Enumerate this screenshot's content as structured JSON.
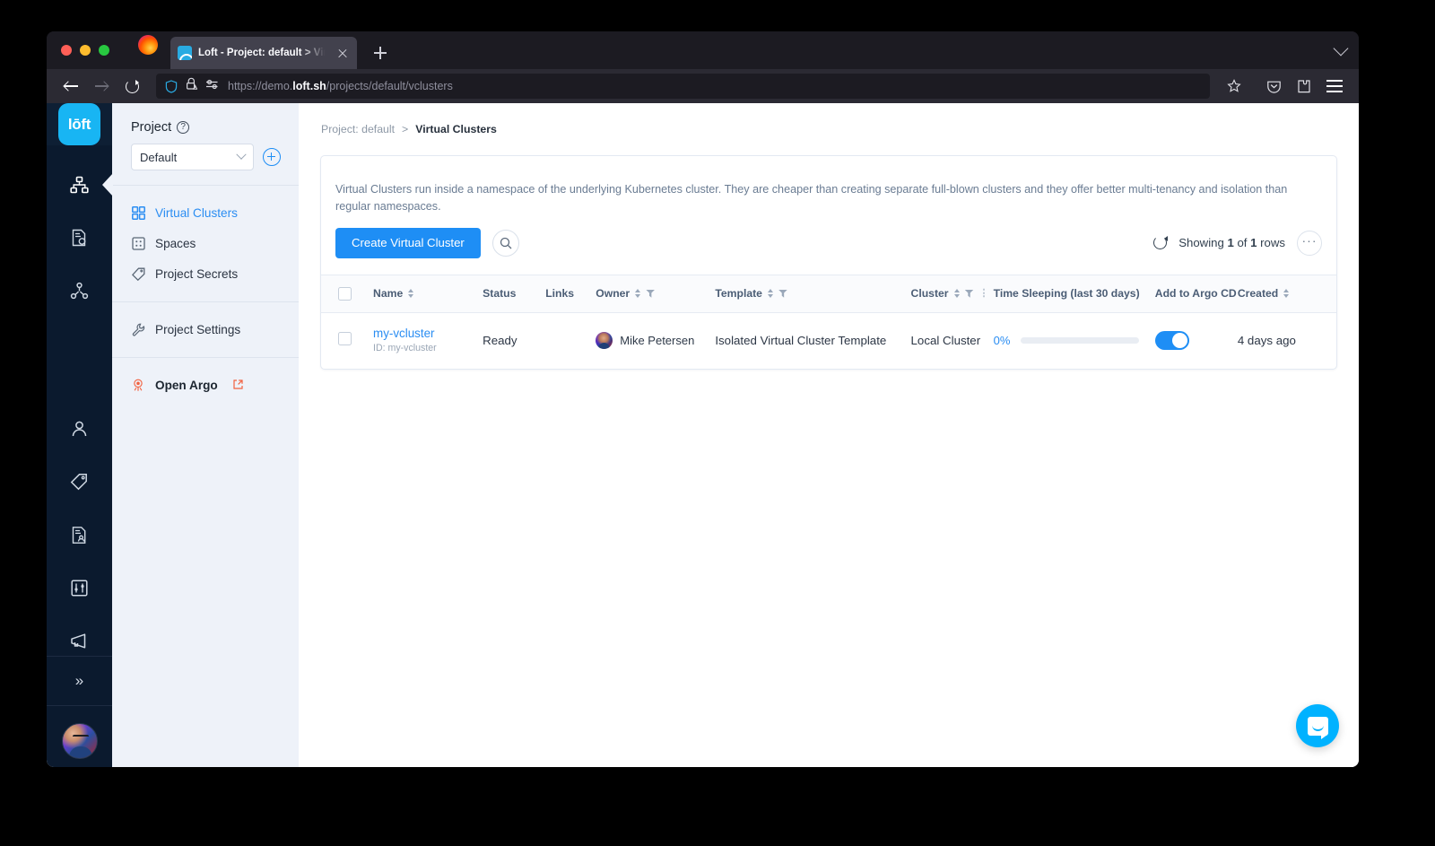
{
  "browser": {
    "tab": {
      "title": "Loft - Project: default > Virtual C",
      "favicon": "loft-favicon"
    },
    "url_scheme": "https://",
    "url_domain_pre": "demo.",
    "url_domain_bold": "loft.sh",
    "url_path": "/projects/default/vclusters",
    "icons": {
      "back": "back-arrow-icon",
      "forward": "forward-arrow-icon",
      "reload": "reload-icon",
      "shield": "shield-icon",
      "lock": "lock-warning-icon",
      "permissions": "permissions-icon",
      "bookmark": "star-icon",
      "pocket": "pocket-icon",
      "extensions": "extensions-icon",
      "menu": "hamburger-menu-icon",
      "newtab": "new-tab-icon",
      "tablist": "tab-list-chevron-icon",
      "close_tab": "close-tab-icon"
    }
  },
  "rail": {
    "logo": "lōft",
    "items": [
      {
        "name": "virtual-clusters",
        "icon": "cluster-grid-icon",
        "active": true
      },
      {
        "name": "spaces",
        "icon": "document-gear-icon",
        "active": false
      },
      {
        "name": "templates",
        "icon": "node-tree-icon",
        "active": false
      },
      {
        "name": "users",
        "icon": "user-icon",
        "active": false
      },
      {
        "name": "tags",
        "icon": "tag-icon",
        "active": false
      },
      {
        "name": "audit",
        "icon": "document-user-icon",
        "active": false
      },
      {
        "name": "config",
        "icon": "sliders-icon",
        "active": false
      },
      {
        "name": "announcements",
        "icon": "megaphone-icon",
        "active": false
      }
    ],
    "expand": "»",
    "avatar": "user-avatar"
  },
  "sidebar": {
    "label": "Project",
    "help_icon": "question-mark-icon",
    "select_value": "Default",
    "add_icon": "plus-circle-icon",
    "groups": [
      {
        "items": [
          {
            "label": "Virtual Clusters",
            "icon": "grid-squares-icon",
            "active": true
          },
          {
            "label": "Spaces",
            "icon": "dotted-square-icon",
            "active": false
          },
          {
            "label": "Project Secrets",
            "icon": "tag-icon",
            "active": false
          }
        ]
      },
      {
        "items": [
          {
            "label": "Project Settings",
            "icon": "wrench-icon",
            "active": false
          }
        ]
      },
      {
        "items": [
          {
            "label": "Open Argo",
            "icon": "argo-octopus-icon",
            "external_icon": "external-link-icon",
            "bold": true
          }
        ]
      }
    ]
  },
  "breadcrumb": {
    "root": "Project: default",
    "sep": ">",
    "current": "Virtual Clusters"
  },
  "main": {
    "description": "Virtual Clusters run inside a namespace of the underlying Kubernetes cluster. They are cheaper than creating separate full-blown clusters and they offer better multi-tenancy and isolation than regular namespaces.",
    "create_button": "Create Virtual Cluster",
    "search_icon": "search-icon",
    "refresh_icon": "refresh-icon",
    "showing_pre": "Showing ",
    "showing_count": "1",
    "showing_mid": " of ",
    "showing_total": "1",
    "showing_post": " rows",
    "more_icon": "ellipsis-icon"
  },
  "table": {
    "columns": [
      {
        "key": "select",
        "label": "",
        "sortable": false,
        "filter": false
      },
      {
        "key": "name",
        "label": "Name",
        "sortable": true,
        "filter": false
      },
      {
        "key": "status",
        "label": "Status",
        "sortable": false,
        "filter": false
      },
      {
        "key": "links",
        "label": "Links",
        "sortable": false,
        "filter": false
      },
      {
        "key": "owner",
        "label": "Owner",
        "sortable": true,
        "filter": true
      },
      {
        "key": "template",
        "label": "Template",
        "sortable": true,
        "filter": true
      },
      {
        "key": "cluster",
        "label": "Cluster",
        "sortable": true,
        "filter": true,
        "dots": true
      },
      {
        "key": "sleeping",
        "label": "Time Sleeping (last 30 days)",
        "sortable": false,
        "filter": false
      },
      {
        "key": "argo",
        "label": "Add to Argo CD",
        "sortable": false,
        "filter": false
      },
      {
        "key": "created",
        "label": "Created",
        "sortable": true,
        "filter": false
      }
    ],
    "rows": [
      {
        "name": "my-vcluster",
        "id_label": "ID: my-vcluster",
        "status": "Ready",
        "links": "",
        "owner": "Mike Petersen",
        "template": "Isolated Virtual Cluster Template",
        "cluster": "Local Cluster",
        "sleep_percent": "0%",
        "sleep_bar_value": 0,
        "argo_enabled": true,
        "created": "4 days ago"
      }
    ]
  },
  "chat": {
    "icon": "intercom-chat-icon"
  },
  "colors": {
    "accent": "#1e8ef5",
    "link": "#2a8df2",
    "rail_bg": "#0b1a2e",
    "sidebar_bg": "#eef2f9",
    "loft_brand": "#18b5f3",
    "chat_bg": "#00b2ff",
    "argo_orange": "#f2613f"
  }
}
